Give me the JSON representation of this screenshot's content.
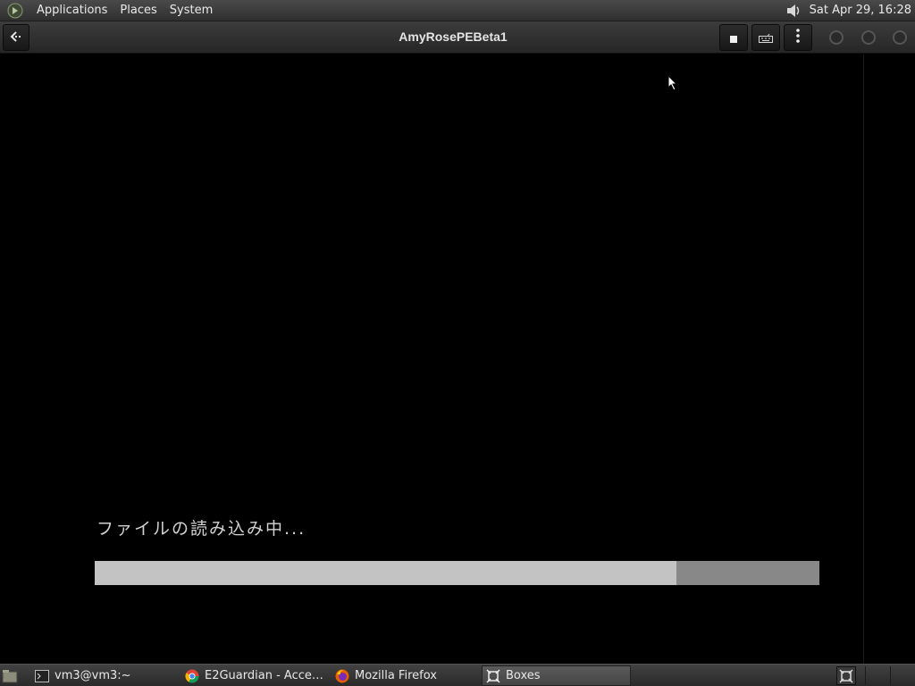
{
  "top_panel": {
    "menus": [
      "Applications",
      "Places",
      "System"
    ],
    "clock": "Sat Apr 29, 16:28",
    "icons": {
      "menu_logo": "gnome-foot-icon",
      "volume": "speaker-icon"
    }
  },
  "headerbar": {
    "title": "AmyRosePEBeta1",
    "buttons": {
      "back": "back-arrow-icon",
      "stop": "stop-square-icon",
      "keys": "keyboard-icon",
      "more": "kebab-menu-icon"
    },
    "window_controls": [
      "minimize",
      "maximize",
      "close"
    ]
  },
  "vm_screen": {
    "loading_text": "ファイルの読み込み中...",
    "progress_fraction": 0.803
  },
  "taskbar": {
    "tasks": [
      {
        "label": "vm3@vm3:~",
        "icon": "terminal-icon"
      },
      {
        "label": "E2Guardian - Acces...",
        "icon": "chrome-icon"
      },
      {
        "label": "Mozilla Firefox",
        "icon": "firefox-icon"
      },
      {
        "label": "Boxes",
        "icon": "boxes-icon",
        "active": true
      }
    ]
  },
  "colors": {
    "panel": "#3a3a3a",
    "progress_fill": "#c3c3c3",
    "progress_track": "#888888",
    "vm_background": "#000000"
  }
}
